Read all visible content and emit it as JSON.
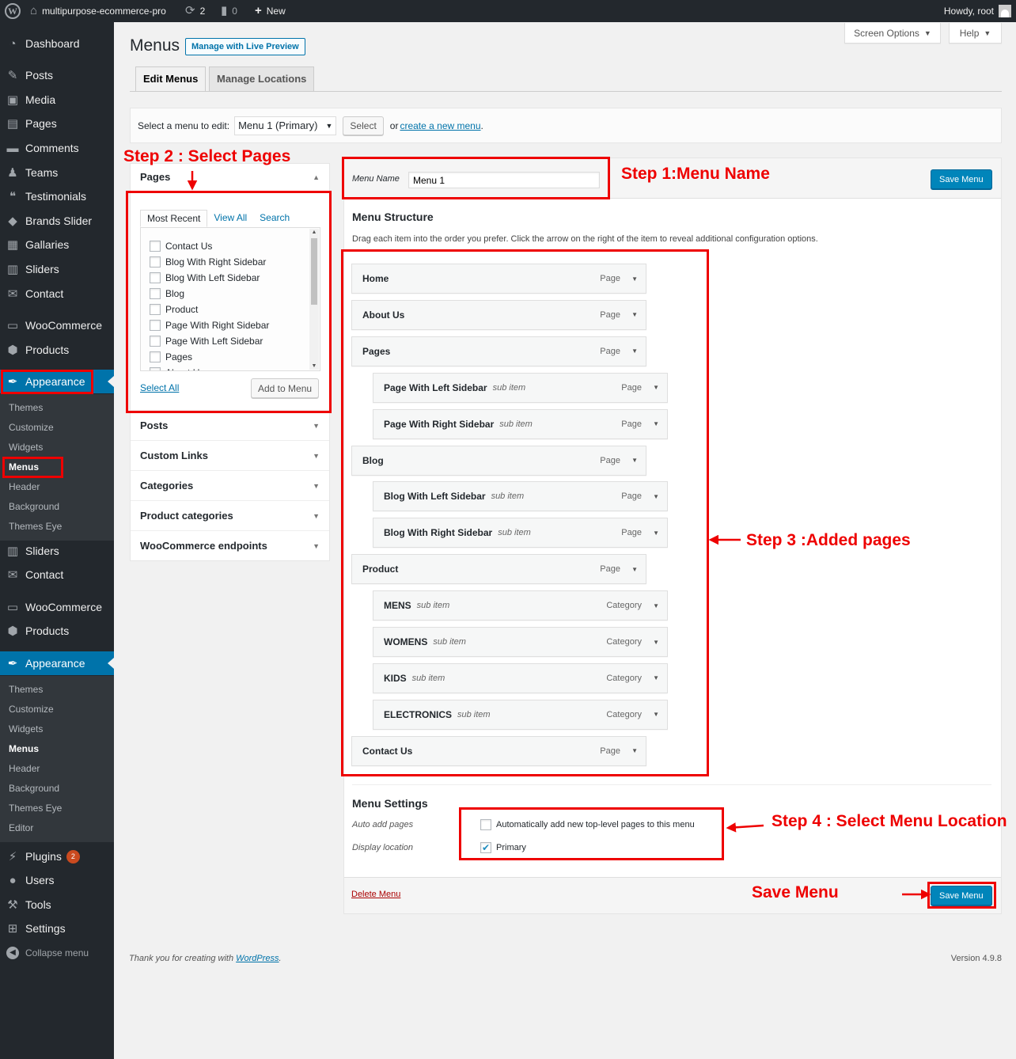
{
  "admin_bar": {
    "site_name": "multipurpose-ecommerce-pro",
    "updates_count": "2",
    "comments_count": "0",
    "new_label": "New",
    "greeting": "Howdy, root"
  },
  "sidebar": {
    "items": [
      {
        "label": "Dashboard",
        "icon": "dashboard-icon"
      },
      {
        "label": "Posts",
        "icon": "pin-icon"
      },
      {
        "label": "Media",
        "icon": "media-icon"
      },
      {
        "label": "Pages",
        "icon": "page-icon"
      },
      {
        "label": "Comments",
        "icon": "comment-icon"
      },
      {
        "label": "Teams",
        "icon": "groups-icon"
      },
      {
        "label": "Testimonials",
        "icon": "testimonial-icon"
      },
      {
        "label": "Brands Slider",
        "icon": "tag-icon"
      },
      {
        "label": "Gallaries",
        "icon": "gallery-icon"
      },
      {
        "label": "Sliders",
        "icon": "slides-icon"
      },
      {
        "label": "Contact",
        "icon": "email-icon"
      },
      {
        "label": "WooCommerce",
        "icon": "woo-icon"
      },
      {
        "label": "Products",
        "icon": "box-icon"
      },
      {
        "label": "Appearance",
        "icon": "brush-icon"
      }
    ],
    "submenu_1": [
      "Themes",
      "Customize",
      "Widgets",
      "Menus",
      "Header",
      "Background",
      "Themes Eye"
    ],
    "items_mid": [
      {
        "label": "Sliders",
        "icon": "slides-icon"
      },
      {
        "label": "Contact",
        "icon": "email-icon"
      },
      {
        "label": "WooCommerce",
        "icon": "woo-icon"
      },
      {
        "label": "Products",
        "icon": "box-icon"
      },
      {
        "label": "Appearance",
        "icon": "brush-icon"
      }
    ],
    "submenu_2": [
      "Themes",
      "Customize",
      "Widgets",
      "Menus",
      "Header",
      "Background",
      "Themes Eye",
      "Editor"
    ],
    "items_bottom": [
      {
        "label": "Plugins",
        "icon": "plugin-icon",
        "badge": "2"
      },
      {
        "label": "Users",
        "icon": "user-icon"
      },
      {
        "label": "Tools",
        "icon": "wrench-icon"
      },
      {
        "label": "Settings",
        "icon": "settings-icon"
      }
    ],
    "collapse_label": "Collapse menu"
  },
  "screen_options": "Screen Options",
  "help": "Help",
  "page": {
    "title": "Menus",
    "live_preview": "Manage with Live Preview",
    "tab_edit": "Edit Menus",
    "tab_locations": "Manage Locations"
  },
  "select_bar": {
    "label": "Select a menu to edit:",
    "selected": "Menu 1 (Primary)",
    "select_btn": "Select",
    "or_text": "or",
    "create_link": "create a new menu",
    "period": "."
  },
  "pages_box": {
    "title": "Pages",
    "tabs": [
      "Most Recent",
      "View All",
      "Search"
    ],
    "items": [
      "Contact Us",
      "Blog With Right Sidebar",
      "Blog With Left Sidebar",
      "Blog",
      "Product",
      "Page With Right Sidebar",
      "Page With Left Sidebar",
      "Pages",
      "About Us"
    ],
    "select_all": "Select All",
    "add_btn": "Add to Menu"
  },
  "accordion": [
    "Posts",
    "Custom Links",
    "Categories",
    "Product categories",
    "WooCommerce endpoints"
  ],
  "menu_editor": {
    "name_label": "Menu Name",
    "name_value": "Menu 1",
    "save_label": "Save Menu",
    "structure_title": "Menu Structure",
    "structure_help": "Drag each item into the order you prefer. Click the arrow on the right of the item to reveal additional configuration options.",
    "sub_item_label": "sub item",
    "items": [
      {
        "title": "Home",
        "type": "Page",
        "sub": false
      },
      {
        "title": "About Us",
        "type": "Page",
        "sub": false
      },
      {
        "title": "Pages",
        "type": "Page",
        "sub": false
      },
      {
        "title": "Page With Left Sidebar",
        "type": "Page",
        "sub": true
      },
      {
        "title": "Page With Right Sidebar",
        "type": "Page",
        "sub": true
      },
      {
        "title": "Blog",
        "type": "Page",
        "sub": false
      },
      {
        "title": "Blog With Left Sidebar",
        "type": "Page",
        "sub": true
      },
      {
        "title": "Blog With Right Sidebar",
        "type": "Page",
        "sub": true
      },
      {
        "title": "Product",
        "type": "Page",
        "sub": false
      },
      {
        "title": "MENS",
        "type": "Category",
        "sub": true
      },
      {
        "title": "WOMENS",
        "type": "Category",
        "sub": true
      },
      {
        "title": "KIDS",
        "type": "Category",
        "sub": true
      },
      {
        "title": "ELECTRONICS",
        "type": "Category",
        "sub": true
      },
      {
        "title": "Contact Us",
        "type": "Page",
        "sub": false
      }
    ],
    "settings_title": "Menu Settings",
    "auto_add_label": "Auto add pages",
    "auto_add_text": "Automatically add new top-level pages to this menu",
    "display_location_label": "Display location",
    "primary_label": "Primary",
    "delete_label": "Delete Menu"
  },
  "annotations": {
    "step1": "Step 1:Menu Name",
    "step2": "Step 2 : Select Pages",
    "step3": "Step 3 :Added pages",
    "step4": "Step 4 : Select Menu Location",
    "save": "Save Menu"
  },
  "footer": {
    "thanks": "Thank you for creating with",
    "wp_link": "WordPress",
    "period": ".",
    "version": "Version 4.9.8"
  },
  "colors": {
    "annotation_red": "#e00000",
    "primary_blue": "#0085ba",
    "sidebar_bg": "#23282d",
    "active_blue": "#0073aa"
  }
}
